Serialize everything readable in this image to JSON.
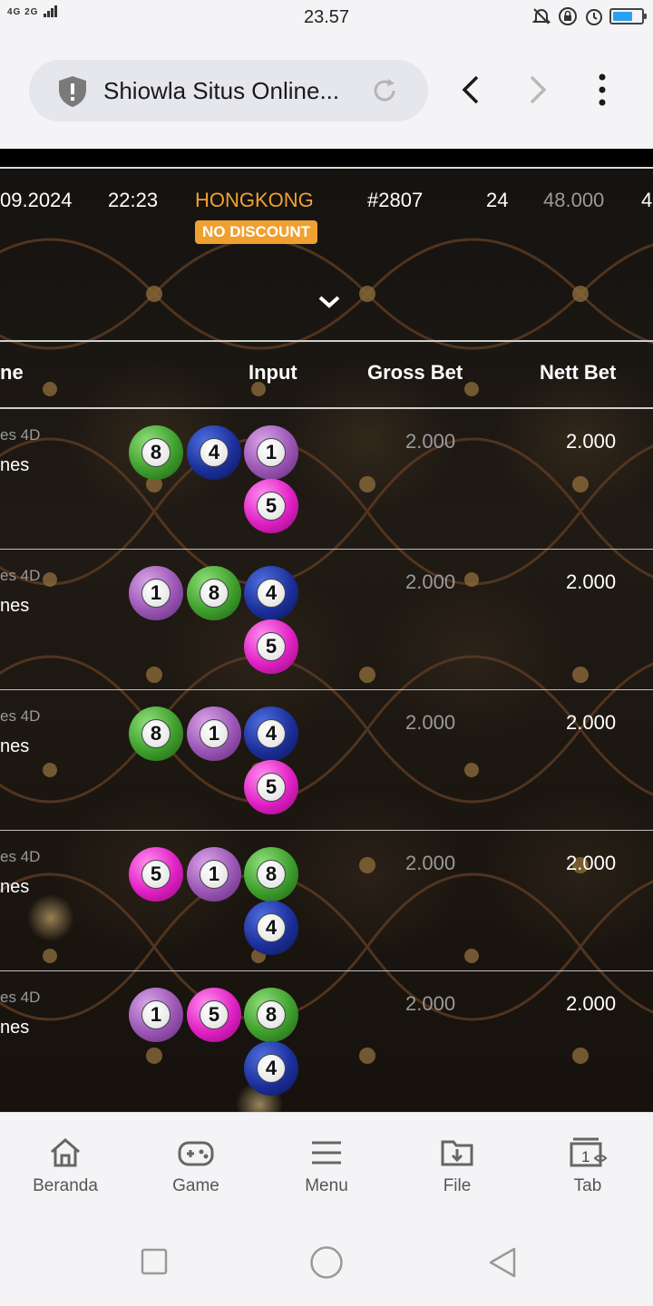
{
  "status_bar": {
    "signal_text": "4G 2G",
    "time": "23.57",
    "icons": [
      "mute-icon",
      "rotation-lock-icon",
      "alarm-icon",
      "battery-icon"
    ],
    "battery_level": 0.7
  },
  "browser": {
    "url_title": "Shiowla Situs Online...",
    "icons": [
      "shield-icon",
      "reload-icon",
      "back-icon",
      "forward-icon",
      "more-icon"
    ]
  },
  "summary": {
    "date": "09.2024",
    "time": "22:23",
    "market": "HONGKONG",
    "badge": "NO DISCOUNT",
    "period": "#2807",
    "count": "24",
    "total": "48.000",
    "extra": "4"
  },
  "table": {
    "headers": {
      "name": "ne",
      "input": "Input",
      "gross": "Gross Bet",
      "nett": "Nett Bet"
    },
    "rows": [
      {
        "type": "es 4D",
        "name": "nes",
        "balls": [
          {
            "n": "8",
            "c": "green"
          },
          {
            "n": "4",
            "c": "blue"
          },
          {
            "n": "1",
            "c": "purple"
          },
          {
            "n": "5",
            "c": "pink"
          }
        ],
        "gross": "2.000",
        "nett": "2.000"
      },
      {
        "type": "es 4D",
        "name": "nes",
        "balls": [
          {
            "n": "1",
            "c": "purple"
          },
          {
            "n": "8",
            "c": "green"
          },
          {
            "n": "4",
            "c": "blue"
          },
          {
            "n": "5",
            "c": "pink"
          }
        ],
        "gross": "2.000",
        "nett": "2.000"
      },
      {
        "type": "es 4D",
        "name": "nes",
        "balls": [
          {
            "n": "8",
            "c": "green"
          },
          {
            "n": "1",
            "c": "purple"
          },
          {
            "n": "4",
            "c": "blue"
          },
          {
            "n": "5",
            "c": "pink"
          }
        ],
        "gross": "2.000",
        "nett": "2.000"
      },
      {
        "type": "es 4D",
        "name": "nes",
        "balls": [
          {
            "n": "5",
            "c": "pink"
          },
          {
            "n": "1",
            "c": "purple"
          },
          {
            "n": "8",
            "c": "green"
          },
          {
            "n": "4",
            "c": "blue"
          }
        ],
        "gross": "2.000",
        "nett": "2.000"
      },
      {
        "type": "es 4D",
        "name": "nes",
        "balls": [
          {
            "n": "1",
            "c": "purple"
          },
          {
            "n": "5",
            "c": "pink"
          },
          {
            "n": "8",
            "c": "green"
          },
          {
            "n": "4",
            "c": "blue"
          }
        ],
        "gross": "2.000",
        "nett": "2.000"
      }
    ]
  },
  "bottom_nav": [
    {
      "label": "Beranda",
      "icon": "home-icon"
    },
    {
      "label": "Game",
      "icon": "gamepad-icon"
    },
    {
      "label": "Menu",
      "icon": "menu-icon"
    },
    {
      "label": "File",
      "icon": "download-folder-icon"
    },
    {
      "label": "Tab",
      "icon": "tabs-icon",
      "tab_count": "1"
    }
  ],
  "system_nav": [
    "recents-icon",
    "home-circle-icon",
    "back-triangle-icon"
  ],
  "colors": {
    "accent_orange": "#f0a030",
    "muted_gray": "#9a9a9a",
    "bg_dark": "#17120d"
  }
}
